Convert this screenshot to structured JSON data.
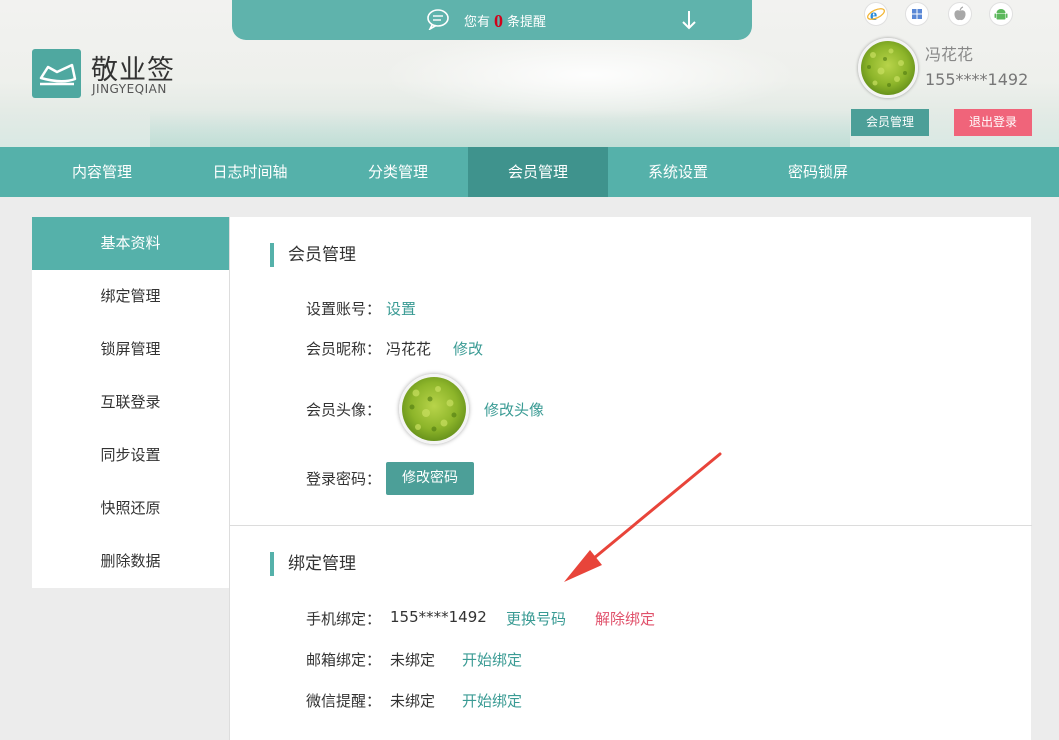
{
  "notice": {
    "prefix": "您有",
    "count": "0",
    "suffix": "条提醒"
  },
  "logo": {
    "title": "敬业签",
    "subtitle": "JINGYEQIAN"
  },
  "user": {
    "name": "冯花花",
    "phone": "155****1492",
    "member_btn": "会员管理",
    "logout_btn": "退出登录"
  },
  "os_icons": [
    "ie-icon",
    "windows-icon",
    "apple-icon",
    "android-icon"
  ],
  "nav": {
    "items": [
      {
        "label": "内容管理",
        "active": false
      },
      {
        "label": "日志时间轴",
        "active": false
      },
      {
        "label": "分类管理",
        "active": false
      },
      {
        "label": "会员管理",
        "active": true
      },
      {
        "label": "系统设置",
        "active": false
      },
      {
        "label": "密码锁屏",
        "active": false
      }
    ]
  },
  "sidebar": {
    "items": [
      {
        "label": "基本资料",
        "active": true
      },
      {
        "label": "绑定管理",
        "active": false
      },
      {
        "label": "锁屏管理",
        "active": false
      },
      {
        "label": "互联登录",
        "active": false
      },
      {
        "label": "同步设置",
        "active": false
      },
      {
        "label": "快照还原",
        "active": false
      },
      {
        "label": "删除数据",
        "active": false
      }
    ]
  },
  "member": {
    "title": "会员管理",
    "account_label": "设置账号：",
    "account_link": "设置",
    "nickname_label": "会员昵称：",
    "nickname_value": "冯花花",
    "nickname_link": "修改",
    "avatar_label": "会员头像：",
    "avatar_link": "修改头像",
    "password_label": "登录密码：",
    "password_btn": "修改密码"
  },
  "binding": {
    "title": "绑定管理",
    "phone_label": "手机绑定：",
    "phone_value": "155****1492",
    "phone_change": "更换号码",
    "phone_unbind": "解除绑定",
    "email_label": "邮箱绑定：",
    "email_value": "未绑定",
    "email_link": "开始绑定",
    "wechat_label": "微信提醒：",
    "wechat_value": "未绑定",
    "wechat_link": "开始绑定"
  },
  "colors": {
    "teal": "#55b1aa",
    "teal_dark": "#3f938d",
    "red": "#e0506a",
    "link": "#3a9b94"
  }
}
